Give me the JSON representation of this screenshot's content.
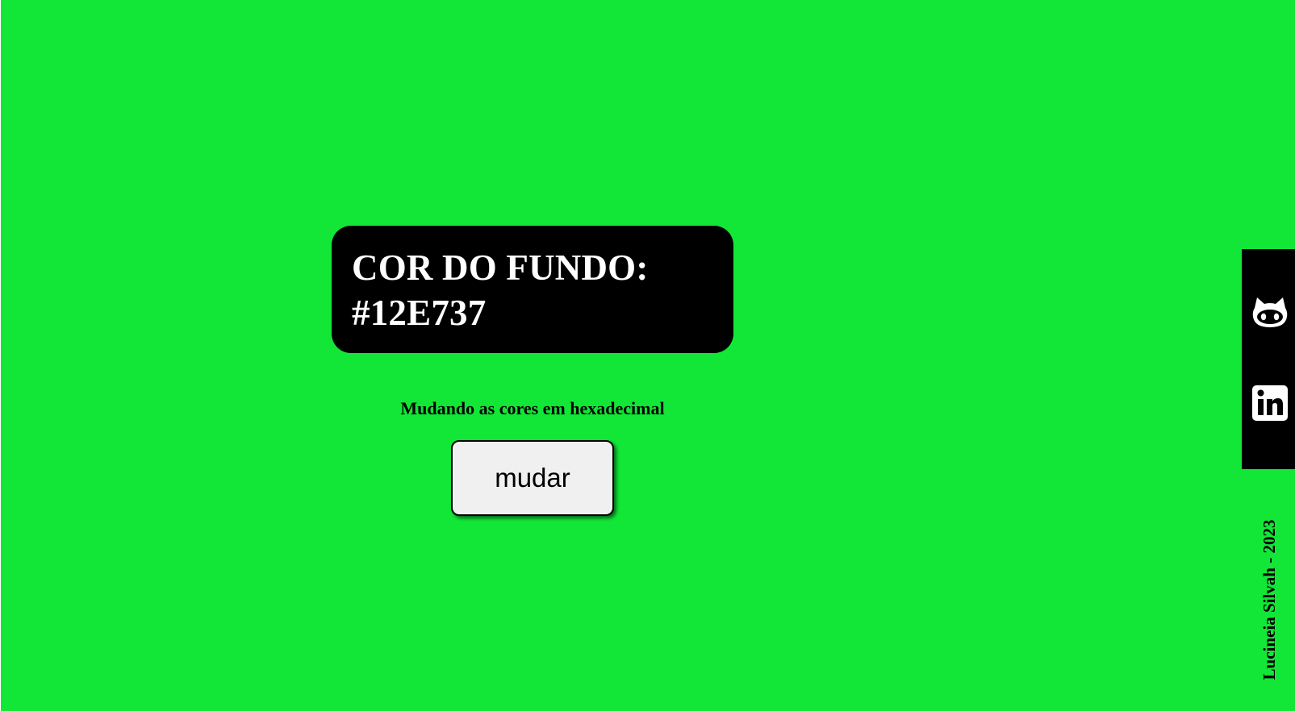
{
  "page": {
    "background_color": "#12E737"
  },
  "color_card": {
    "label": "COR DO FUNDO:",
    "value": "#12E737"
  },
  "subtitle": "Mudando as cores em hexadecimal",
  "button": {
    "label": "mudar"
  },
  "social": {
    "items": [
      {
        "name": "GitHub",
        "icon": "github-icon"
      },
      {
        "name": "LinkedIn",
        "icon": "linkedin-icon"
      }
    ]
  },
  "footer": {
    "credit": "Lucineia Silvah - 2023"
  }
}
